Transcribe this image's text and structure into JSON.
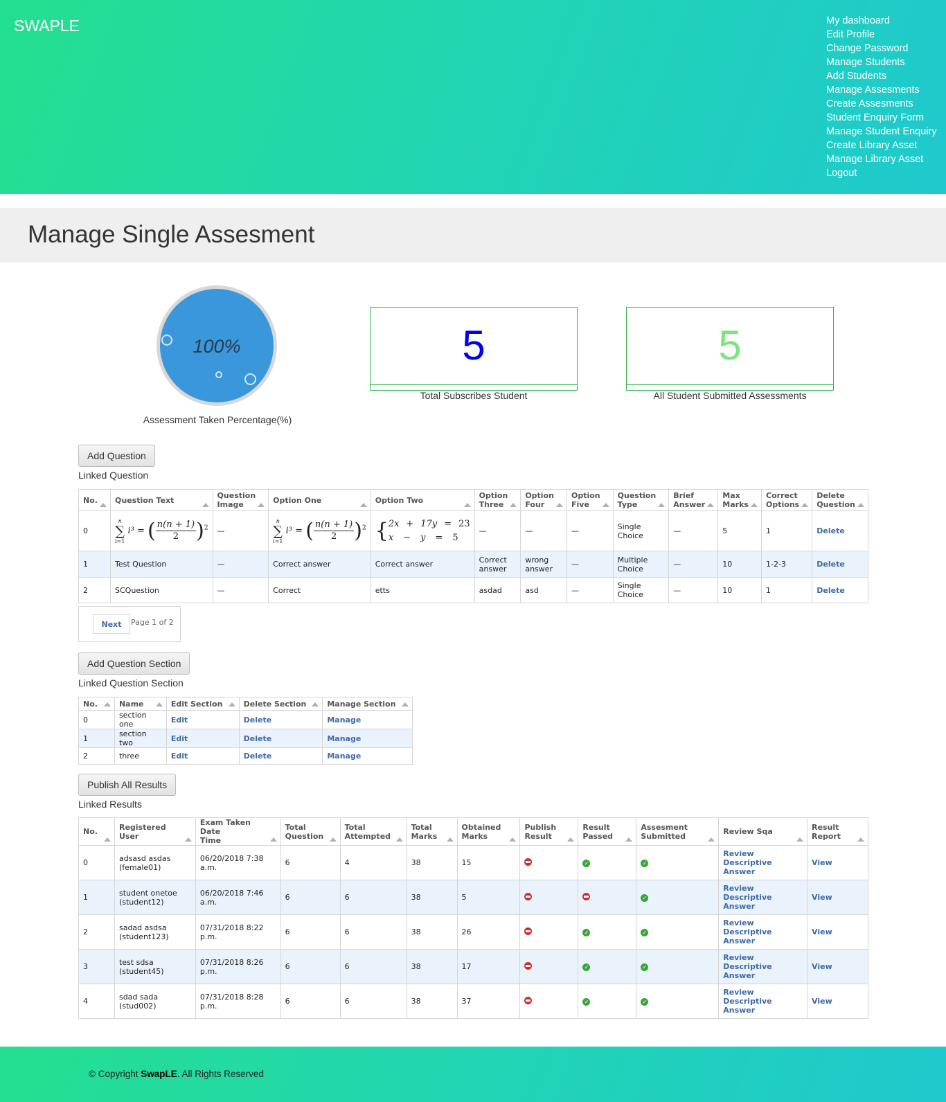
{
  "brand": "SWAPLE",
  "nav": [
    "My dashboard",
    "Edit Profile",
    "Change Password",
    "Manage Students",
    "Add Students",
    "Manage Assesments",
    "Create Assesments",
    "Student Enquiry Form",
    "Manage Student Enquiry",
    "Create Library Asset",
    "Manage Library Asset",
    "Logout"
  ],
  "page_title": "Manage Single Assesment",
  "stats": {
    "percentage": "100%",
    "percentage_label": "Assessment Taken Percentage(%)",
    "total_subscribed": "5",
    "total_subscribed_label": "Total Subscribes Student",
    "submitted": "5",
    "submitted_label": "All Student Submitted Assessments",
    "colors": {
      "gauge": "#3a97dc",
      "subscribed": "#0000ee",
      "submitted": "#7ee47e"
    }
  },
  "questions": {
    "button": "Add Question",
    "title": "Linked Question",
    "headers": [
      [
        "No.",
        ""
      ],
      [
        "Question Text",
        ""
      ],
      [
        "Question",
        "Image"
      ],
      [
        "Option One",
        ""
      ],
      [
        "Option Two",
        ""
      ],
      [
        "Option",
        "Three"
      ],
      [
        "Option",
        "Four"
      ],
      [
        "Option",
        "Five"
      ],
      [
        "Question",
        "Type"
      ],
      [
        "Brief",
        "Answer"
      ],
      [
        "Max",
        "Marks"
      ],
      [
        "Correct",
        "Options"
      ],
      [
        "Delete",
        "Question"
      ]
    ],
    "rows": [
      {
        "no": "0",
        "text": "",
        "image": "—",
        "one": "",
        "two": "",
        "three": "—",
        "four": "—",
        "five": "—",
        "type": [
          "Single",
          "Choice"
        ],
        "brief": "—",
        "marks": "5",
        "correct": "1",
        "delete": "Delete"
      },
      {
        "no": "1",
        "text": "Test Question",
        "image": "—",
        "one": "Correct answer",
        "two": "Correct answer",
        "three": [
          "Correct",
          "answer"
        ],
        "four": [
          "wrong",
          "answer"
        ],
        "five": "—",
        "type": [
          "Multiple",
          "Choice"
        ],
        "brief": "—",
        "marks": "10",
        "correct": "1-2-3",
        "delete": "Delete"
      },
      {
        "no": "2",
        "text": "SCQuestion",
        "image": "—",
        "one": "Correct",
        "two": "etts",
        "three": "asdad",
        "four": "asd",
        "five": "—",
        "type": [
          "Single",
          "Choice"
        ],
        "brief": "—",
        "marks": "10",
        "correct": "1",
        "delete": "Delete"
      }
    ],
    "math": {
      "sum_top": "n",
      "sum_sym": "∑",
      "sum_bottom": "i=1",
      "term": "i³ =",
      "frac_num": "n(n + 1)",
      "frac_den": "2",
      "power": "2",
      "sys_r1": [
        "2x",
        "+",
        "17y",
        "=",
        "23"
      ],
      "sys_r2": [
        "x",
        "−",
        "y",
        "=",
        "5"
      ]
    },
    "pager": {
      "next": "Next",
      "page_text": "Page 1 of 2"
    }
  },
  "sections": {
    "button": "Add Question Section",
    "title": "Linked Question Section",
    "headers": [
      "No.",
      "Name",
      "Edit Section",
      "Delete Section",
      "Manage Section"
    ],
    "rows": [
      {
        "no": "0",
        "name": "section one",
        "edit": "Edit",
        "delete": "Delete",
        "manage": "Manage"
      },
      {
        "no": "1",
        "name": "section two",
        "edit": "Edit",
        "delete": "Delete",
        "manage": "Manage"
      },
      {
        "no": "2",
        "name": "three",
        "edit": "Edit",
        "delete": "Delete",
        "manage": "Manage"
      }
    ]
  },
  "results": {
    "button": "Publish All Results",
    "title": "Linked Results",
    "headers": [
      [
        "No.",
        ""
      ],
      [
        "Registered",
        "User"
      ],
      [
        "Exam Taken Date",
        "Time"
      ],
      [
        "Total",
        "Question"
      ],
      [
        "Total",
        "Attempted"
      ],
      [
        "Total",
        "Marks"
      ],
      [
        "Obtained",
        "Marks"
      ],
      [
        "Publish",
        "Result"
      ],
      [
        "Result",
        "Passed"
      ],
      [
        "Assesment",
        "Submitted"
      ],
      [
        "Review Sqa",
        ""
      ],
      [
        "Result",
        "Report"
      ]
    ],
    "rows": [
      {
        "no": "0",
        "user": [
          "adsasd asdas",
          "(female01)"
        ],
        "date": [
          "06/20/2018 7:38",
          "a.m."
        ],
        "total_q": "6",
        "attempted": "4",
        "marks": "38",
        "obtained": "15",
        "publish": "no",
        "passed": "yes",
        "submitted": "yes",
        "review": [
          "Review",
          "Descriptive",
          "Answer"
        ],
        "report": "View"
      },
      {
        "no": "1",
        "user": [
          "student onetoe",
          "(student12)"
        ],
        "date": [
          "06/20/2018 7:46",
          "a.m."
        ],
        "total_q": "6",
        "attempted": "6",
        "marks": "38",
        "obtained": "5",
        "publish": "no",
        "passed": "no",
        "submitted": "yes",
        "review": [
          "Review",
          "Descriptive",
          "Answer"
        ],
        "report": "View"
      },
      {
        "no": "2",
        "user": [
          "sadad asdsa",
          "(student123)"
        ],
        "date": [
          "07/31/2018 8:22",
          "p.m."
        ],
        "total_q": "6",
        "attempted": "6",
        "marks": "38",
        "obtained": "26",
        "publish": "no",
        "passed": "yes",
        "submitted": "yes",
        "review": [
          "Review",
          "Descriptive",
          "Answer"
        ],
        "report": "View"
      },
      {
        "no": "3",
        "user": [
          "test sdsa",
          "(student45)"
        ],
        "date": [
          "07/31/2018 8:26",
          "p.m."
        ],
        "total_q": "6",
        "attempted": "6",
        "marks": "38",
        "obtained": "17",
        "publish": "no",
        "passed": "yes",
        "submitted": "yes",
        "review": [
          "Review",
          "Descriptive",
          "Answer"
        ],
        "report": "View"
      },
      {
        "no": "4",
        "user": [
          "sdad sada",
          "(stud002)"
        ],
        "date": [
          "07/31/2018 8:28",
          "p.m."
        ],
        "total_q": "6",
        "attempted": "6",
        "marks": "38",
        "obtained": "37",
        "publish": "no",
        "passed": "yes",
        "submitted": "yes",
        "review": [
          "Review",
          "Descriptive",
          "Answer"
        ],
        "report": "View"
      }
    ]
  },
  "footer": {
    "prefix": "© Copyright ",
    "brand": "SwapLE",
    "suffix": ". All Rights Reserved"
  }
}
